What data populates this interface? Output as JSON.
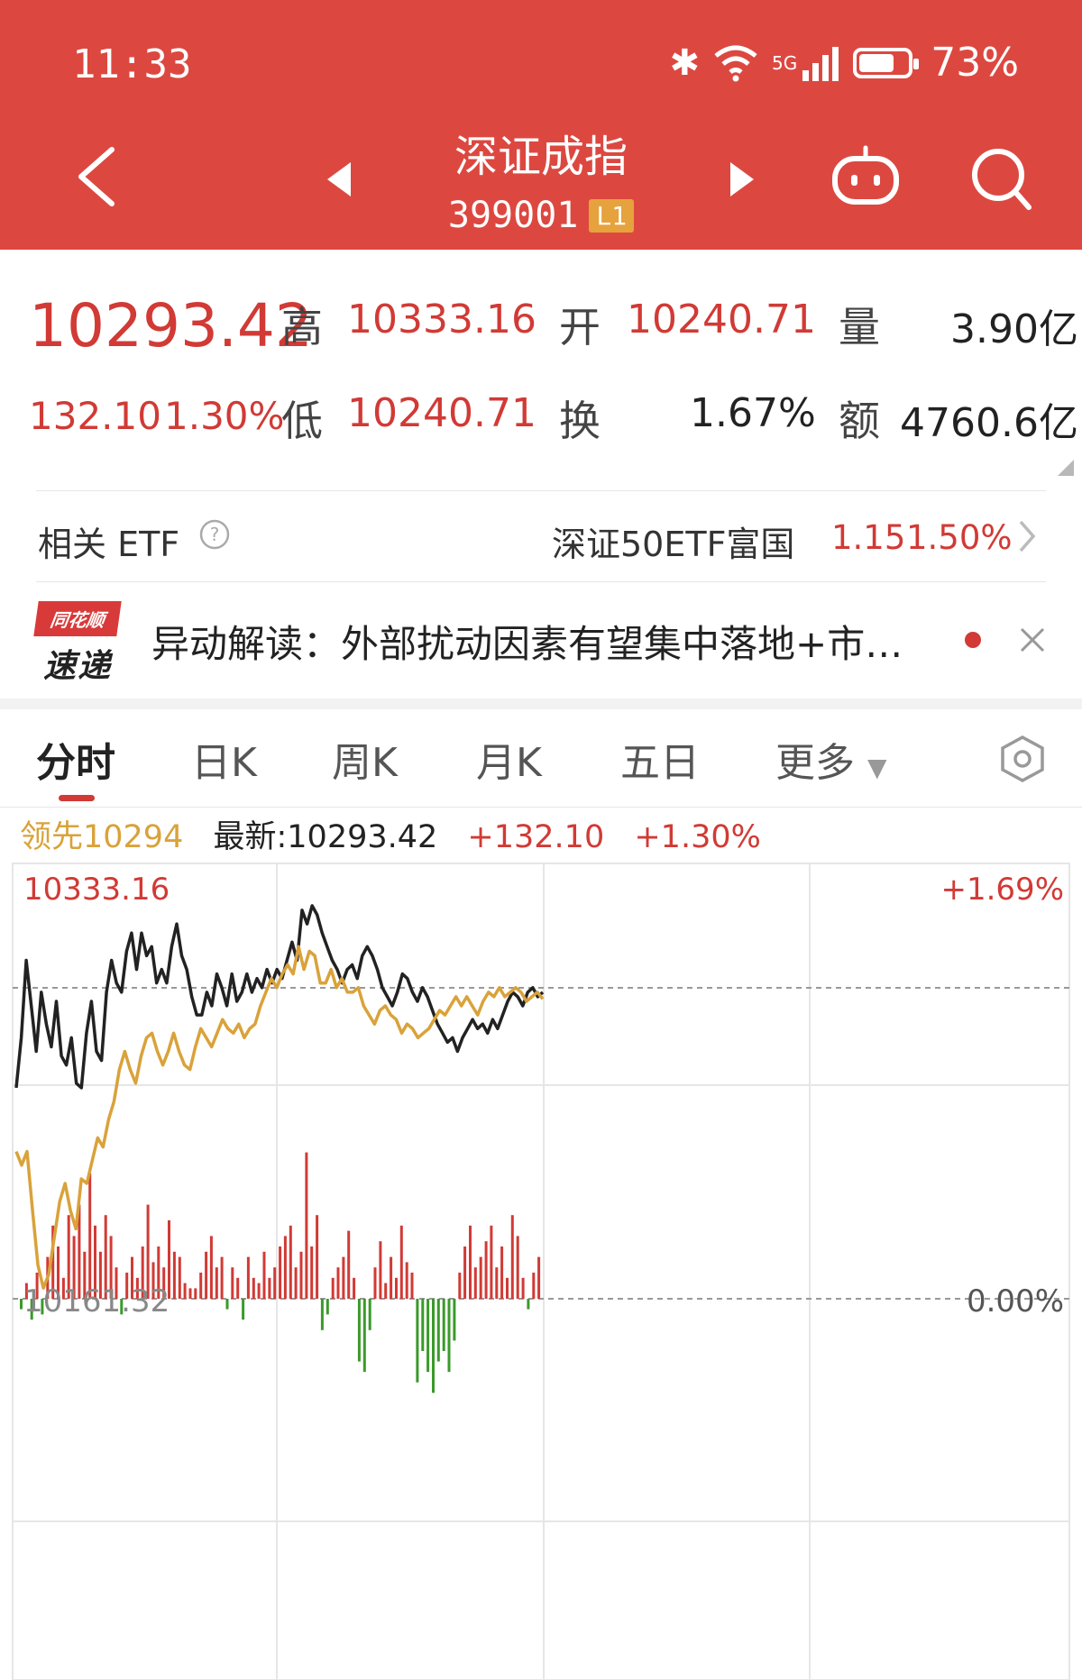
{
  "status_bar": {
    "time": "11:33",
    "network": "5G",
    "battery_text": "73%",
    "battery_level": 0.73
  },
  "header": {
    "title": "深证成指",
    "code": "399001",
    "level_badge": "L1"
  },
  "quote": {
    "last": "10293.42",
    "change": "132.10",
    "change_pct": "1.30%",
    "high_label": "高",
    "high": "10333.16",
    "low_label": "低",
    "low": "10240.71",
    "open_label": "开",
    "open": "10240.71",
    "turnover_label": "换",
    "turnover": "1.67%",
    "volume_label": "量",
    "volume": "3.90亿",
    "amount_label": "额",
    "amount": "4760.6亿"
  },
  "etf": {
    "label": "相关 ETF",
    "name": "深证50ETF富国",
    "price": "1.15",
    "pct": "1.50%"
  },
  "news": {
    "logo_top": "同花顺",
    "logo_bottom": "速递",
    "text": "异动解读：外部扰动因素有望集中落地+市…"
  },
  "tabs": [
    {
      "label": "分时"
    },
    {
      "label": "日K"
    },
    {
      "label": "周K"
    },
    {
      "label": "月K"
    },
    {
      "label": "五日"
    },
    {
      "label": "更多"
    }
  ],
  "info_bar": {
    "lead": "领先10294",
    "latest": "最新:10293.42",
    "change": "+132.10",
    "pct": "+1.30%"
  },
  "chart_data": {
    "type": "line",
    "y_labels": {
      "top_left": "10333.16",
      "top_right": "+1.69%",
      "mid_left": "10161.32",
      "mid_right": "0.00%"
    },
    "ylim": [
      10161.32,
      10333.16
    ],
    "colors": {
      "price": "#222222",
      "lead": "#d9a23a",
      "up": "#d13a35",
      "down": "#3a9a2a",
      "grid": "#e6e6e6"
    },
    "x": [
      0,
      1,
      2,
      3,
      4,
      5,
      6,
      7,
      8,
      9,
      10,
      11,
      12,
      13,
      14,
      15,
      16,
      17,
      18,
      19,
      20,
      21,
      22,
      23,
      24,
      25,
      26,
      27,
      28,
      29,
      30,
      31,
      32,
      33,
      34,
      35,
      36,
      37,
      38,
      39,
      40,
      41,
      42,
      43,
      44,
      45,
      46,
      47,
      48,
      49,
      50,
      51,
      52,
      53,
      54,
      55,
      56,
      57,
      58,
      59,
      60,
      61,
      62,
      63,
      64,
      65,
      66,
      67,
      68,
      69,
      70,
      71,
      72,
      73,
      74,
      75,
      76,
      77,
      78,
      79,
      80,
      81,
      82,
      83,
      84,
      85,
      86,
      87,
      88,
      89,
      90,
      91,
      92,
      93,
      94,
      95,
      96,
      97,
      98,
      99,
      100,
      101,
      102,
      103,
      104,
      105,
      106,
      107,
      108,
      109,
      110,
      111,
      112,
      113,
      114,
      115,
      116,
      117,
      118,
      119
    ],
    "series": [
      {
        "values": [
          10254,
          10276,
          10310,
          10290,
          10270,
          10296,
          10282,
          10272,
          10292,
          10268,
          10264,
          10276,
          10256,
          10254,
          10278,
          10292,
          10270,
          10266,
          10296,
          10310,
          10300,
          10296,
          10314,
          10322,
          10306,
          10322,
          10312,
          10316,
          10300,
          10306,
          10300,
          10316,
          10326,
          10312,
          10306,
          10294,
          10286,
          10286,
          10296,
          10290,
          10304,
          10298,
          10290,
          10304,
          10292,
          10296,
          10304,
          10296,
          10302,
          10298,
          10306,
          10300,
          10306,
          10302,
          10310,
          10318,
          10310,
          10332,
          10326,
          10334,
          10330,
          10322,
          10316,
          10310,
          10306,
          10300,
          10306,
          10308,
          10302,
          10312,
          10316,
          10312,
          10306,
          10298,
          10294,
          10290,
          10296,
          10304,
          10302,
          10296,
          10292,
          10298,
          10294,
          10288,
          10282,
          10278,
          10274,
          10276,
          10270,
          10276,
          10280,
          10284,
          10280,
          10282,
          10278,
          10284,
          10280,
          10286,
          10292,
          10296,
          10294,
          10290,
          10296,
          10298,
          10294,
          10296
        ],
        "color_key": "price"
      },
      {
        "values": [
          10226,
          10220,
          10226,
          10200,
          10176,
          10166,
          10172,
          10188,
          10204,
          10212,
          10200,
          10192,
          10214,
          10212,
          10222,
          10232,
          10228,
          10240,
          10248,
          10262,
          10270,
          10262,
          10256,
          10268,
          10276,
          10278,
          10270,
          10264,
          10270,
          10278,
          10270,
          10264,
          10262,
          10272,
          10280,
          10276,
          10272,
          10278,
          10284,
          10280,
          10278,
          10282,
          10276,
          10280,
          10282,
          10290,
          10296,
          10302,
          10298,
          10304,
          10308,
          10304,
          10316,
          10306,
          10314,
          10312,
          10300,
          10300,
          10306,
          10298,
          10302,
          10296,
          10296,
          10298,
          10290,
          10286,
          10282,
          10288,
          10290,
          10286,
          10284,
          10278,
          10282,
          10280,
          10276,
          10278,
          10280,
          10284,
          10288,
          10286,
          10290,
          10294,
          10290,
          10294,
          10290,
          10286,
          10292,
          10296,
          10294,
          10298,
          10294,
          10296,
          10298,
          10296,
          10292,
          10294,
          10296,
          10293
        ],
        "color_key": "lead"
      }
    ],
    "volume_bars": [
      -2,
      3,
      -4,
      5,
      -3,
      8,
      14,
      10,
      4,
      16,
      12,
      18,
      9,
      24,
      14,
      9,
      16,
      12,
      6,
      -3,
      5,
      8,
      4,
      10,
      18,
      7,
      10,
      6,
      15,
      9,
      8,
      3,
      2,
      2,
      5,
      9,
      12,
      6,
      8,
      -2,
      6,
      4,
      -4,
      8,
      4,
      3,
      9,
      4,
      6,
      10,
      12,
      14,
      6,
      9,
      28,
      10,
      16,
      -6,
      -3,
      4,
      6,
      8,
      13,
      4,
      -12,
      -14,
      -6,
      6,
      11,
      3,
      8,
      4,
      14,
      7,
      5,
      -16,
      -10,
      -14,
      -18,
      -12,
      -10,
      -14,
      -8,
      5,
      10,
      14,
      6,
      8,
      11,
      14,
      6,
      10,
      4,
      16,
      12,
      4,
      -2,
      5,
      8
    ],
    "grid": true
  }
}
